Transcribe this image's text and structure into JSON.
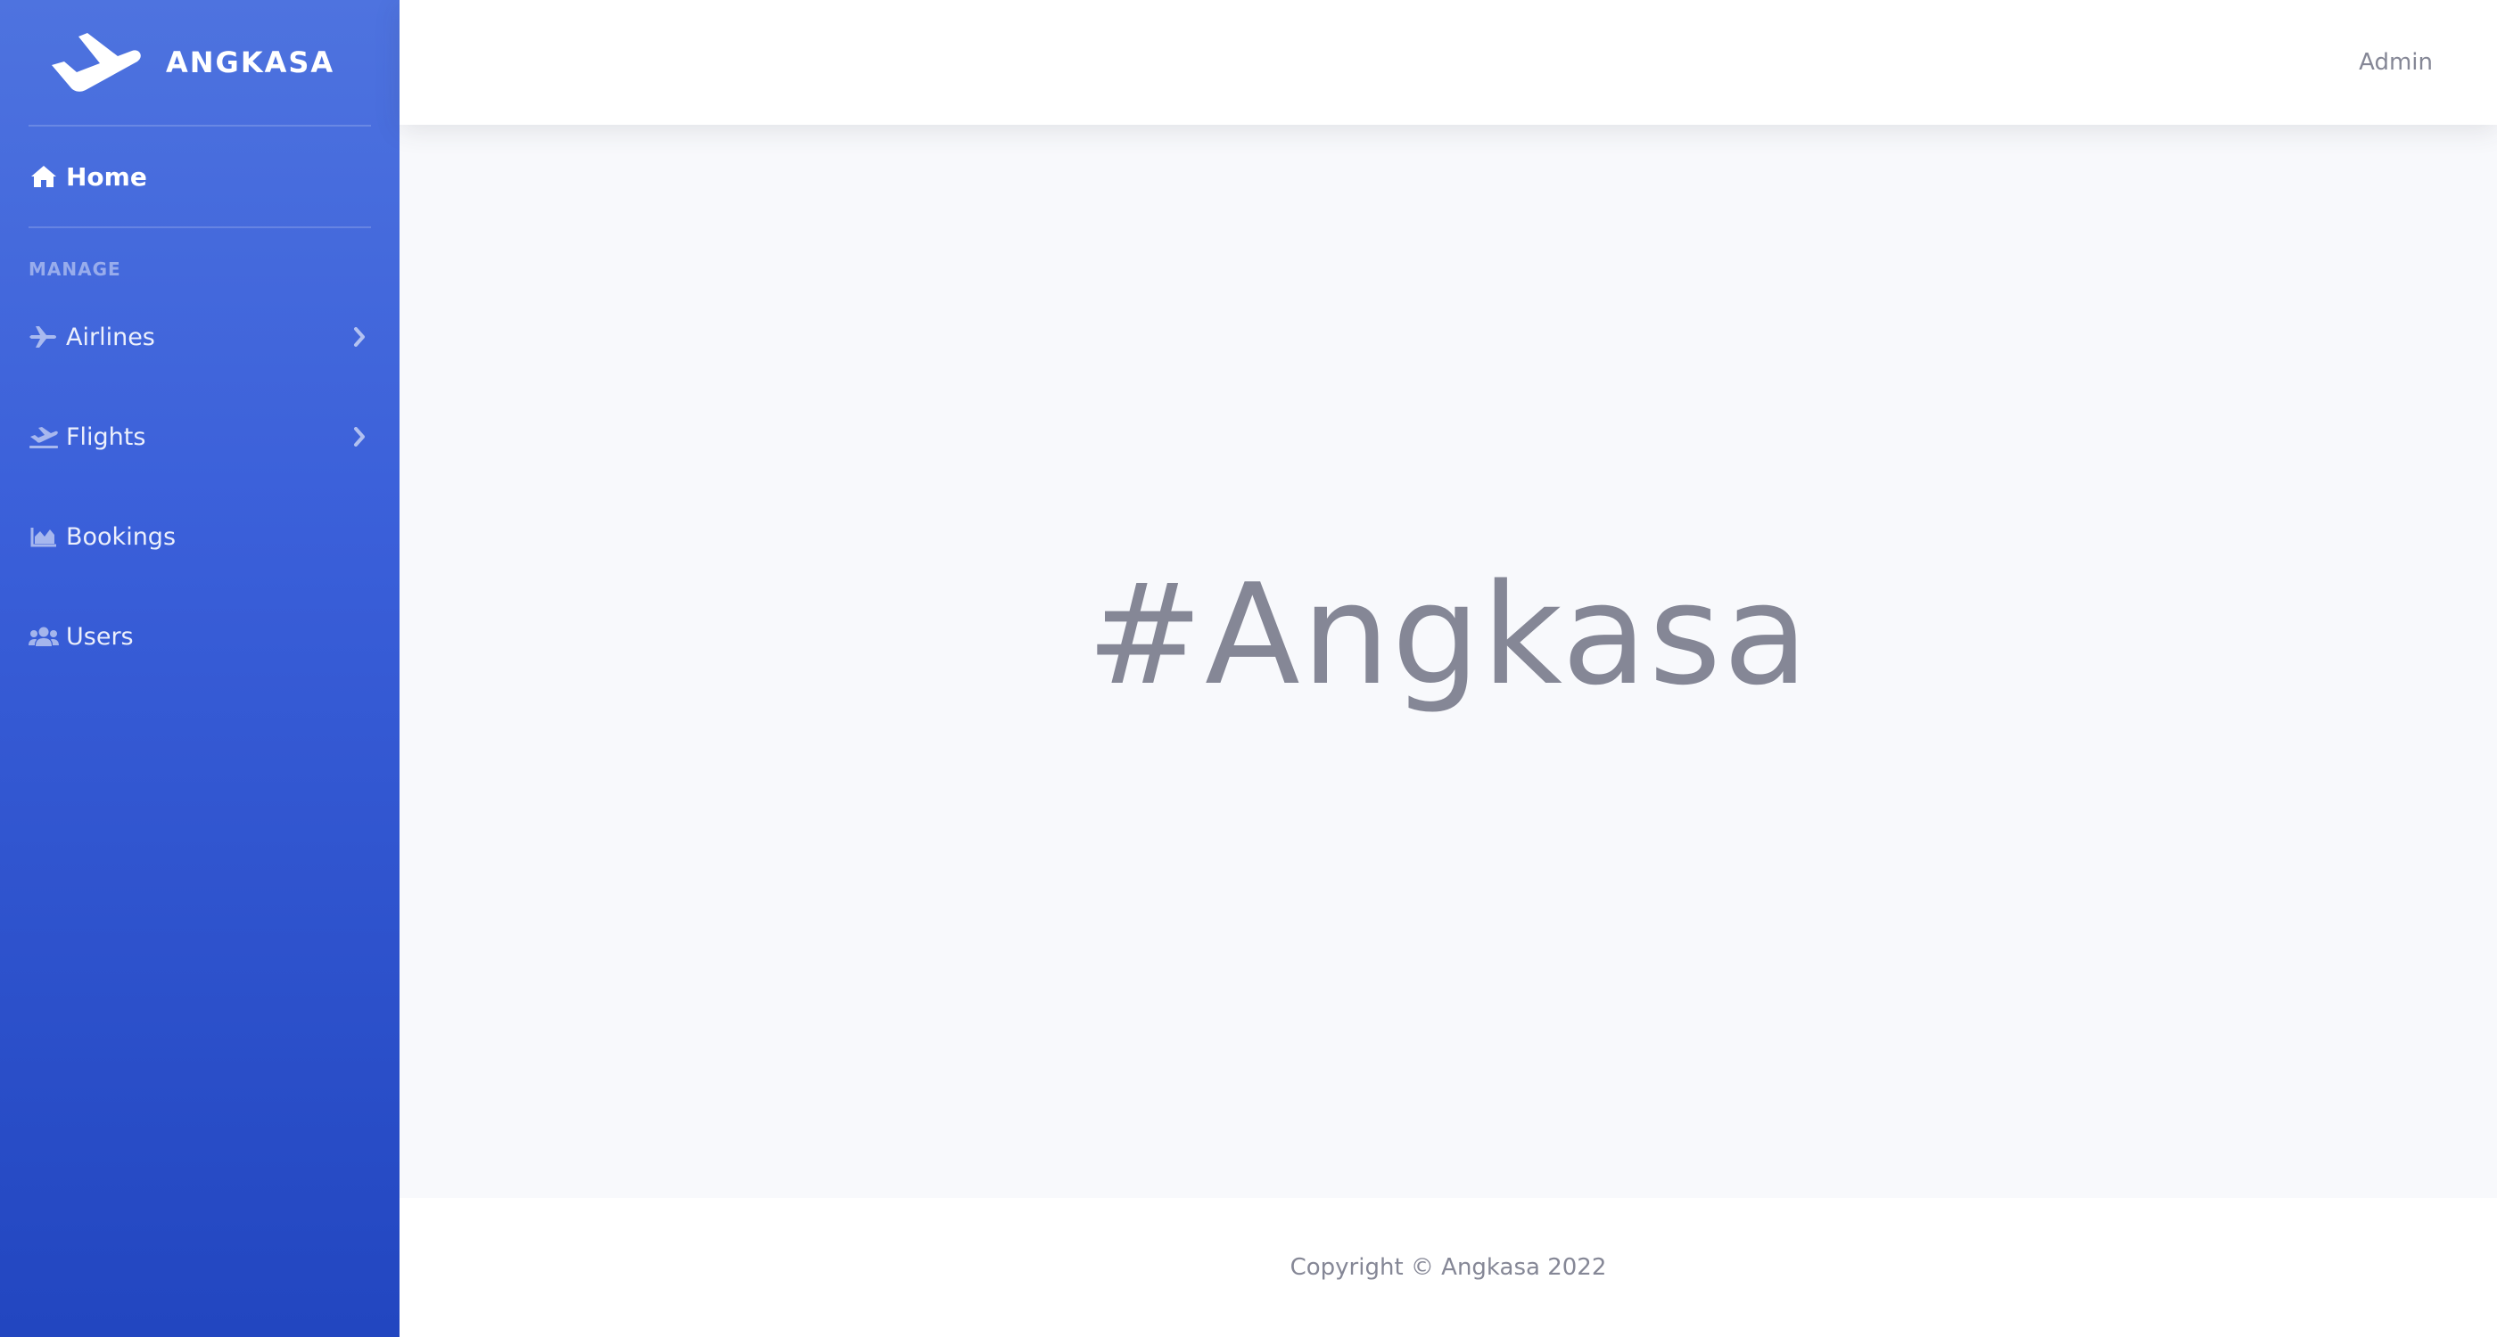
{
  "brand": {
    "name": "ANGKASA",
    "icon": "plane-departure-icon"
  },
  "sidebar": {
    "home": {
      "label": "Home",
      "icon": "home-icon"
    },
    "heading": "MANAGE",
    "items": [
      {
        "label": "Airlines",
        "icon": "plane-icon",
        "has_submenu": true
      },
      {
        "label": "Flights",
        "icon": "plane-departure-icon",
        "has_submenu": true
      },
      {
        "label": "Bookings",
        "icon": "chart-area-icon",
        "has_submenu": false
      },
      {
        "label": "Users",
        "icon": "users-icon",
        "has_submenu": false
      }
    ]
  },
  "topbar": {
    "user": "Admin"
  },
  "main": {
    "hero": "#Angkasa"
  },
  "footer": {
    "text": "Copyright © Angkasa 2022"
  },
  "colors": {
    "sidebar_top": "#4e73df",
    "sidebar_bottom": "#2246c0",
    "text_muted": "#858796",
    "background": "#f8f9fc"
  }
}
